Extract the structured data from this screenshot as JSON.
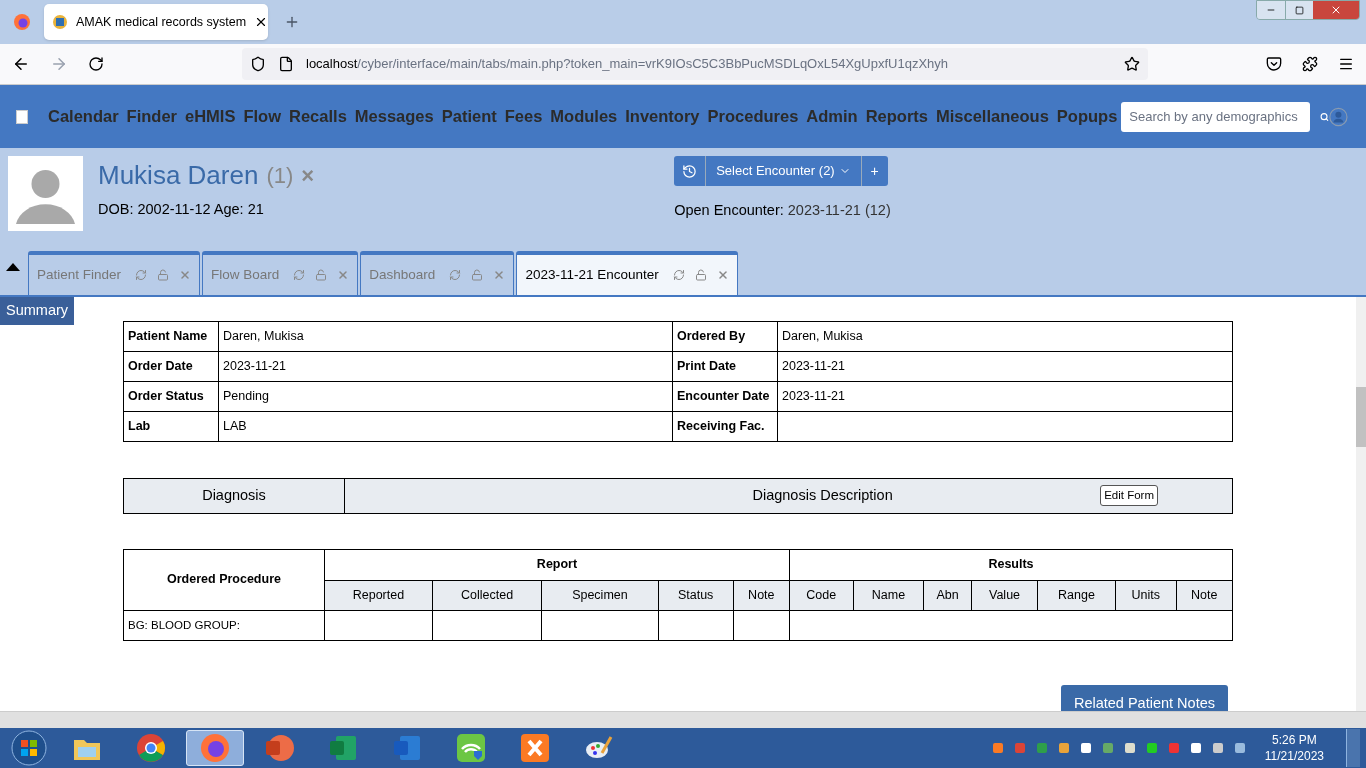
{
  "browser": {
    "tab_title": "AMAK medical records system",
    "url_host": "localhost",
    "url_path": "/cyber/interface/main/tabs/main.php?token_main=vrK9IOsC5C3BbPucMSDLqOxL54XgUpxfU1qzXhyh"
  },
  "nav": {
    "items": [
      "Calendar",
      "Finder",
      "eHMIS",
      "Flow",
      "Recalls",
      "Messages",
      "Patient",
      "Fees",
      "Modules",
      "Inventory",
      "Procedures",
      "Admin",
      "Reports",
      "Miscellaneous",
      "Popups"
    ],
    "search_placeholder": "Search by any demographics"
  },
  "patient": {
    "name": "Mukisa Daren",
    "count": "(1)",
    "close": "×",
    "dob_age": "DOB: 2002-11-12 Age: 21"
  },
  "encounter": {
    "select_label": "Select Encounter",
    "select_count": "(2)",
    "add": "+",
    "open_label": "Open Encounter:",
    "open_value": "2023-11-21 (12)"
  },
  "tabs": [
    {
      "label": "Patient Finder",
      "selected": false
    },
    {
      "label": "Flow Board",
      "selected": false
    },
    {
      "label": "Dashboard",
      "selected": false
    },
    {
      "label": "2023-11-21 Encounter",
      "selected": true
    }
  ],
  "summary_label": "Summary",
  "order_info": [
    {
      "label": "Patient Name",
      "value": "Daren, Mukisa",
      "label2": "Ordered By",
      "value2": "Daren, Mukisa"
    },
    {
      "label": "Order Date",
      "value": "2023-11-21",
      "label2": "Print Date",
      "value2": "2023-11-21"
    },
    {
      "label": "Order Status",
      "value": "Pending",
      "label2": "Encounter Date",
      "value2": "2023-11-21"
    },
    {
      "label": "Lab",
      "value": "LAB",
      "label2": "Receiving Fac."
    }
  ],
  "diagnosis": {
    "headers": [
      "Diagnosis",
      "Diagnosis Description"
    ],
    "edit_button": "Edit Form"
  },
  "procedures": {
    "heading": "Ordered Procedure",
    "report_heading": "Report",
    "results_heading": "Results",
    "report_columns": [
      "Reported",
      "Collected",
      "Specimen",
      "Status",
      "Note"
    ],
    "results_columns": [
      "Code",
      "Name",
      "Abn",
      "Value",
      "Range",
      "Units",
      "Note"
    ],
    "rows": [
      {
        "procedure": "BG: BLOOD GROUP:"
      }
    ]
  },
  "related_notes_button": "Related Patient Notes",
  "taskbar": {
    "apps": [
      {
        "kind": "folder",
        "selected": false
      },
      {
        "kind": "chrome",
        "selected": false
      },
      {
        "kind": "firefox",
        "selected": true
      },
      {
        "kind": "powerpoint",
        "selected": false
      },
      {
        "kind": "excel",
        "selected": false
      },
      {
        "kind": "word",
        "selected": false
      },
      {
        "kind": "wifi",
        "selected": false
      },
      {
        "kind": "xampp",
        "selected": false
      },
      {
        "kind": "paint",
        "selected": false
      }
    ],
    "time": "5:26 PM",
    "date": "11/21/2023"
  }
}
